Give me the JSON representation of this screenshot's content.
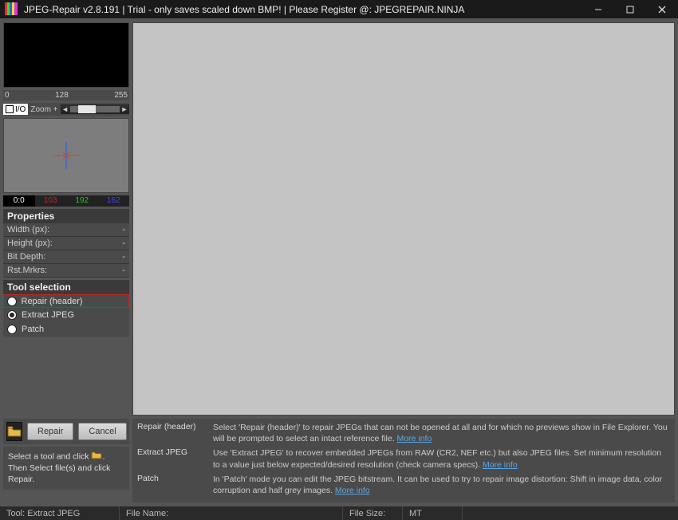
{
  "title": "JPEG-Repair v2.8.191 | Trial - only saves scaled down BMP! | Please Register @: JPEGREPAIR.NINJA",
  "histogram": {
    "labels": [
      "0",
      "128",
      "255"
    ]
  },
  "io": {
    "label": "I/O"
  },
  "zoom": {
    "label": "Zoom +"
  },
  "rgb": {
    "black": "0:0",
    "r": "103",
    "g": "192",
    "b": "162"
  },
  "properties": {
    "header": "Properties",
    "rows": [
      {
        "label": "Width (px):",
        "value": "-"
      },
      {
        "label": "Height (px):",
        "value": "-"
      },
      {
        "label": "Bit Depth:",
        "value": "-"
      },
      {
        "label": "Rst.Mrkrs:",
        "value": "-"
      }
    ]
  },
  "tools": {
    "header": "Tool selection",
    "options": [
      {
        "label": "Repair (header)",
        "selected": false,
        "highlight": true
      },
      {
        "label": "Extract JPEG",
        "selected": true,
        "highlight": false
      },
      {
        "label": "Patch",
        "selected": false,
        "highlight": false
      }
    ]
  },
  "actions": {
    "repair": "Repair",
    "cancel": "Cancel"
  },
  "hint": {
    "pre": "Select a tool and click ",
    "post": ". Then Select file(s) and click Repair."
  },
  "help": {
    "repair_header": {
      "label": "Repair (header)",
      "text": "Select 'Repair (header)' to repair JPEGs that can not be opened at all and for which no previews show in File Explorer. You will be prompted to select an intact reference file. ",
      "link": "More info"
    },
    "extract": {
      "label": "Extract JPEG",
      "text": "Use 'Extract JPEG' to recover embedded JPEGs from RAW (CR2, NEF etc.) but also JPEG files. Set minimum resolution to a value just below expected/desired resolution (check camera specs). ",
      "link": "More info"
    },
    "patch": {
      "label": "Patch",
      "text": "In 'Patch' mode you can edit the JPEG bitstream. It can be used to try to repair image distortion: Shift in image data, color corruption and half grey images. ",
      "link": "More info"
    }
  },
  "status": {
    "tool": "Tool: Extract JPEG",
    "filename": "File Name:",
    "filesize": "File Size:",
    "mt": "MT"
  }
}
